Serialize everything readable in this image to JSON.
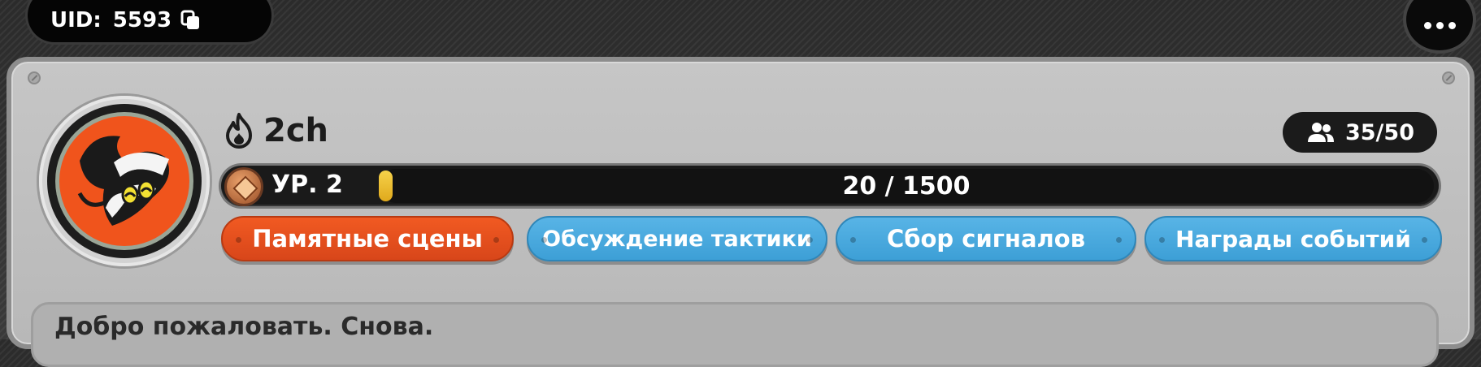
{
  "header": {
    "uid_label": "UID:",
    "uid_value": "5593",
    "copy_icon": "copy-icon",
    "menu_icon": "more-dots-icon"
  },
  "guild": {
    "icon": "flame-icon",
    "name": "2ch",
    "members": "35/50",
    "members_icon": "members-icon",
    "level_label": "УР. 2",
    "xp_text": "20 / 1500",
    "xp_fraction": 0.0133
  },
  "tabs": [
    {
      "label": "Памятные сцены",
      "active": true
    },
    {
      "label": "Обсуждение тактики",
      "active": false
    },
    {
      "label": "Сбор сигналов",
      "active": false
    },
    {
      "label": "Награды событий",
      "active": false
    }
  ],
  "welcome": {
    "message": "Добро пожаловать. Снова."
  },
  "colors": {
    "active_tab": "#f15a22",
    "inactive_tab": "#4aa9de",
    "xp_fill": "#f2c23a",
    "avatar_orange": "#f0541c"
  }
}
